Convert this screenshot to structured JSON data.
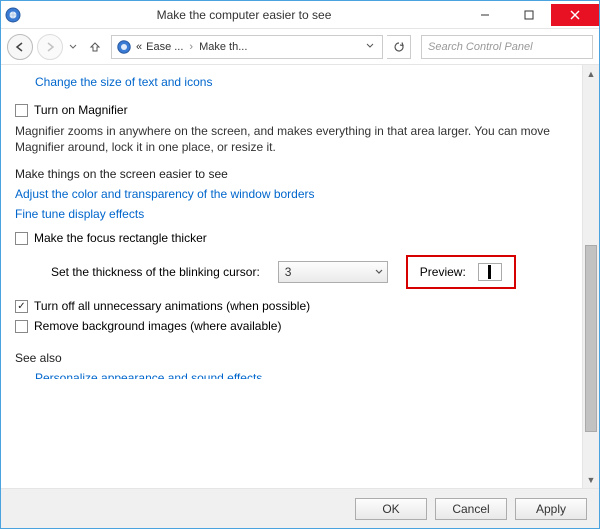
{
  "window": {
    "title": "Make the computer easier to see"
  },
  "nav": {
    "breadcrumb_prefix": "«",
    "crumb1": "Ease ...",
    "crumb2": "Make th...",
    "search_placeholder": "Search Control Panel"
  },
  "content": {
    "link_change_size": "Change the size of text and icons",
    "magnifier_checkbox_label": "Turn on Magnifier",
    "magnifier_desc": "Magnifier zooms in anywhere on the screen, and makes everything in that area larger. You can move Magnifier around, lock it in one place, or resize it.",
    "section_make_easier": "Make things on the screen easier to see",
    "link_adjust_borders": "Adjust the color and transparency of the window borders",
    "link_fine_tune": "Fine tune display effects",
    "focus_rect_label": "Make the focus rectangle thicker",
    "cursor_thickness_label": "Set the thickness of the blinking cursor:",
    "cursor_thickness_value": "3",
    "preview_label": "Preview:",
    "animations_label": "Turn off all unnecessary animations (when possible)",
    "remove_bg_label": "Remove background images (where available)",
    "section_see_also": "See also",
    "link_personalize_cutoff": "Personalize appearance and sound effects"
  },
  "footer": {
    "ok": "OK",
    "cancel": "Cancel",
    "apply": "Apply"
  }
}
